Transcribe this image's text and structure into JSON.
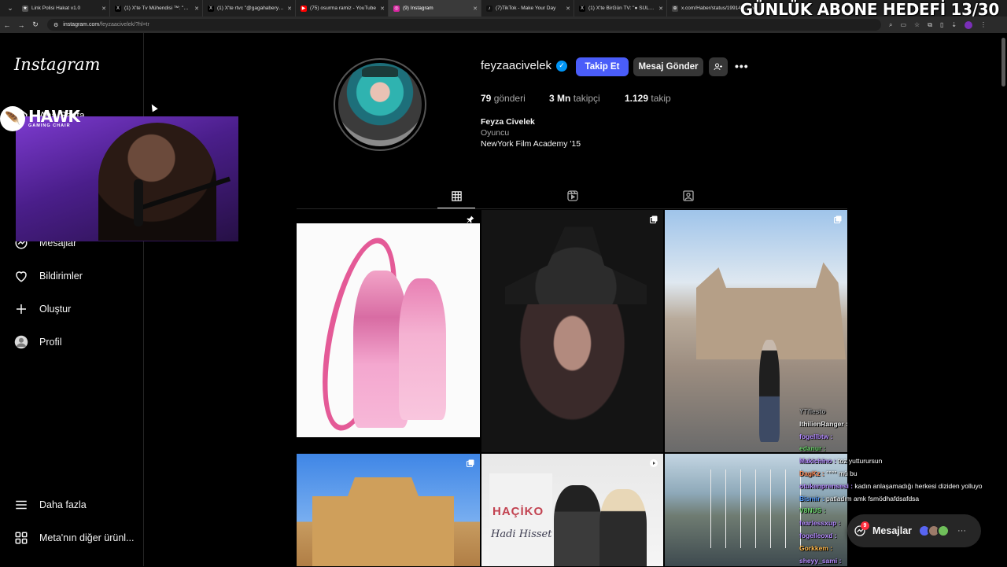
{
  "browser": {
    "tabs": [
      {
        "title": "Link Polisi Hakat v1.0",
        "fav_color": "#555555",
        "fav": "★",
        "active": false
      },
      {
        "title": "(1) X'te Tv Mühendisi ™: \"Bez B",
        "fav_color": "#000000",
        "fav": "X",
        "active": false
      },
      {
        "title": "(1) X'te rtvc \"@gagahaberyeni A",
        "fav_color": "#000000",
        "fav": "X",
        "active": false
      },
      {
        "title": "(75) osurma ramiz - YouTube",
        "fav_color": "#ff0000",
        "fav": "▶",
        "active": false
      },
      {
        "title": "(9) Instagram",
        "fav_color": "#d6249f",
        "fav": "◎",
        "active": true
      },
      {
        "title": "(7)TikTok - Make Your Day",
        "fav_color": "#111111",
        "fav": "♪",
        "active": false
      },
      {
        "title": "(1) X'te BirGün TV: \"● SÜLEYM",
        "fav_color": "#000000",
        "fav": "X",
        "active": false
      },
      {
        "title": "x.com/Haber/status/19914043",
        "fav_color": "#444444",
        "fav": "⊕",
        "active": false
      }
    ],
    "url_host": "instagram.com",
    "url_path": "/feyzaacivelek/?hl=tr"
  },
  "overlay": {
    "goal_text": "GÜNLÜK ABONE HEDEFİ 13/30",
    "brand": "HAWK",
    "brand_sub": "GAMING CHAIR"
  },
  "sidebar": {
    "logo": "Instagram",
    "home_partial": "Ana Sayfa",
    "items": {
      "messages": "Mesajlar",
      "notifications": "Bildirimler",
      "create": "Oluştur",
      "profile": "Profil",
      "more": "Daha fazla",
      "meta": "Meta'nın diğer ürünl..."
    }
  },
  "profile": {
    "username": "feyzaacivelek",
    "follow_label": "Takip Et",
    "message_label": "Mesaj Gönder",
    "stats": [
      {
        "value": "79",
        "label": "gönderi"
      },
      {
        "value": "3 Mn",
        "label": "takipçi"
      },
      {
        "value": "1.129",
        "label": "takip"
      }
    ],
    "full_name": "Feyza Civelek",
    "category": "Oyuncu",
    "bio_line": "NewYork Film Academy '15"
  },
  "posts": {
    "p5_text_1": "HAÇİKO",
    "p5_text_2": "Hadi Hisset"
  },
  "chat": [
    {
      "user": "YTfiesto",
      "msg": "",
      "color": "#9a9a9a"
    },
    {
      "user": "IthilienRanger :",
      "msg": "",
      "color": "#e8e8e8"
    },
    {
      "user": "fogellbtw :",
      "msg": "",
      "color": "#b58cff"
    },
    {
      "user": "edanur :",
      "msg": "",
      "color": "#6fd66f"
    },
    {
      "user": "Makichino :",
      "msg": "toz yutturursun",
      "color": "#b58cff"
    },
    {
      "user": "DagKz :",
      "msg": "°°°° mü bu",
      "color": "#ff8c5a"
    },
    {
      "user": "otukenprensesi :",
      "msg": "kadın anlaşamadığı herkesi diziden yolluyo",
      "color": "#b58cff"
    },
    {
      "user": "Bismir :",
      "msg": "patladım amk fsmödhafdsafdsa",
      "color": "#5aa0ff"
    },
    {
      "user": "V8NUS :",
      "msg": "",
      "color": "#6fd66f"
    },
    {
      "user": "fearlessxup :",
      "msg": "",
      "color": "#b58cff"
    },
    {
      "user": "fogelleoxd :",
      "msg": "",
      "color": "#b58cff"
    },
    {
      "user": "Gorkkem :",
      "msg": "",
      "color": "#ffb84a"
    },
    {
      "user": "sheyy_sami :",
      "msg": "",
      "color": "#b58cff"
    }
  ],
  "messages_pill": {
    "label": "Mesajlar",
    "badge": "9"
  }
}
